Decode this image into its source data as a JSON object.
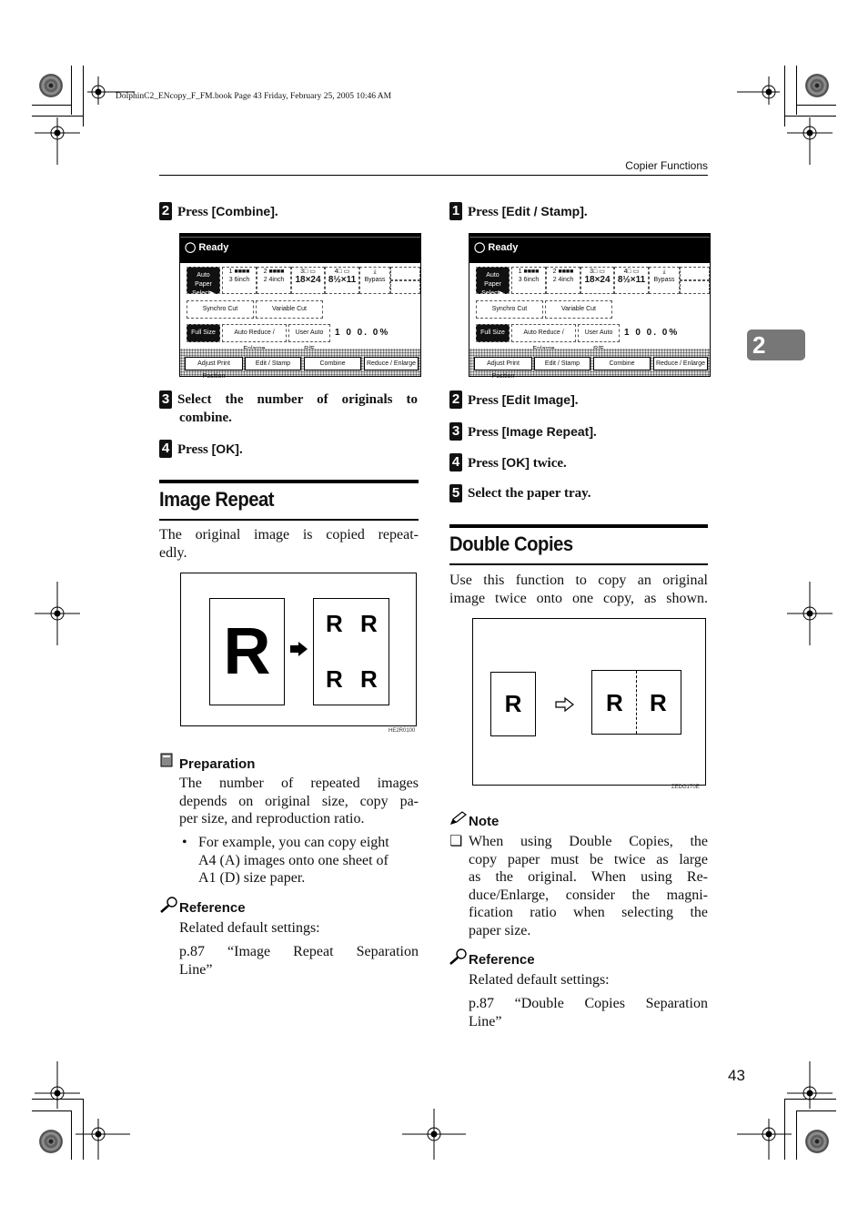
{
  "print_info": "DolphinC2_ENcopy_F_FM.book  Page 43  Friday, February 25, 2005  10:46 AM",
  "header": {
    "section": "Copier Functions"
  },
  "chapter_tab": "2",
  "page_number": "43",
  "left_column": {
    "step2": {
      "num": "2",
      "prefix": "Press ",
      "key": "[Combine]",
      "suffix": "."
    },
    "panel": {
      "status": "Ready",
      "auto_paper": [
        "Auto Paper",
        "Select▶"
      ],
      "trays": [
        {
          "label": "1 ■■■■",
          "size": "3 6inch"
        },
        {
          "label": "2 ■■■■",
          "size": "2 4inch"
        },
        {
          "label": "3□ ▭",
          "size": "18×24"
        },
        {
          "label": "4□ ▭",
          "size": "8½×11"
        },
        {
          "label": "⤓",
          "size": "Bypass"
        }
      ],
      "cut_buttons": [
        "Synchro Cut",
        "Variable Cut"
      ],
      "ratio_buttons": [
        "Full Size",
        "Auto Reduce / Enlarge",
        "User Auto R/E"
      ],
      "ratio": "1 0 0. 0%",
      "bottom_buttons": [
        "Adjust Print Position",
        "Edit / Stamp",
        "Combine",
        "Reduce / Enlarge"
      ]
    },
    "step3": {
      "num": "3",
      "text_line1": "Select the number of originals to",
      "text_line2": "combine."
    },
    "step4": {
      "num": "4",
      "prefix": "Press ",
      "key": "[OK]",
      "suffix": "."
    },
    "section": {
      "title": "Image Repeat",
      "intro_line1": "The original image is copied repeat-",
      "intro_line2": "edly.",
      "figure": {
        "letter": "R",
        "caption": "HE2R0100"
      },
      "preparation": {
        "title": "Preparation",
        "lines": [
          "The number of repeated images",
          "depends on original size, copy pa-",
          "per size, and reproduction ratio."
        ],
        "bullet_lines": [
          "For example, you can copy eight",
          "A4 (A) images onto one sheet of",
          "A1 (D) size paper."
        ]
      },
      "reference": {
        "title": "Reference",
        "line1": "Related default settings:",
        "line2": "p.87 “Image Repeat Separation",
        "line3": "Line”"
      }
    }
  },
  "right_column": {
    "step1": {
      "num": "1",
      "prefix": "Press ",
      "key": "[Edit / Stamp]",
      "suffix": "."
    },
    "step2": {
      "num": "2",
      "prefix": "Press ",
      "key": "[Edit Image]",
      "suffix": "."
    },
    "step3": {
      "num": "3",
      "prefix": "Press ",
      "key": "[Image Repeat]",
      "suffix": "."
    },
    "step4": {
      "num": "4",
      "prefix": "Press ",
      "key": "[OK]",
      "suffix": " twice."
    },
    "step5": {
      "num": "5",
      "text": "Select the paper tray."
    },
    "section": {
      "title": "Double Copies",
      "intro_line1": "Use this function to copy an original",
      "intro_line2": "image twice onto one copy, as shown.",
      "figure": {
        "letter": "R",
        "caption": "ZEDG170E"
      },
      "note": {
        "title": "Note",
        "lines": [
          "When using Double Copies, the",
          "copy paper must be twice as large",
          "as the original. When using Re-",
          "duce/Enlarge, consider the magni-",
          "fication ratio when selecting the",
          "paper size."
        ]
      },
      "reference": {
        "title": "Reference",
        "line1": "Related default settings:",
        "line2": "p.87 “Double Copies Separation",
        "line3": "Line”"
      }
    }
  }
}
